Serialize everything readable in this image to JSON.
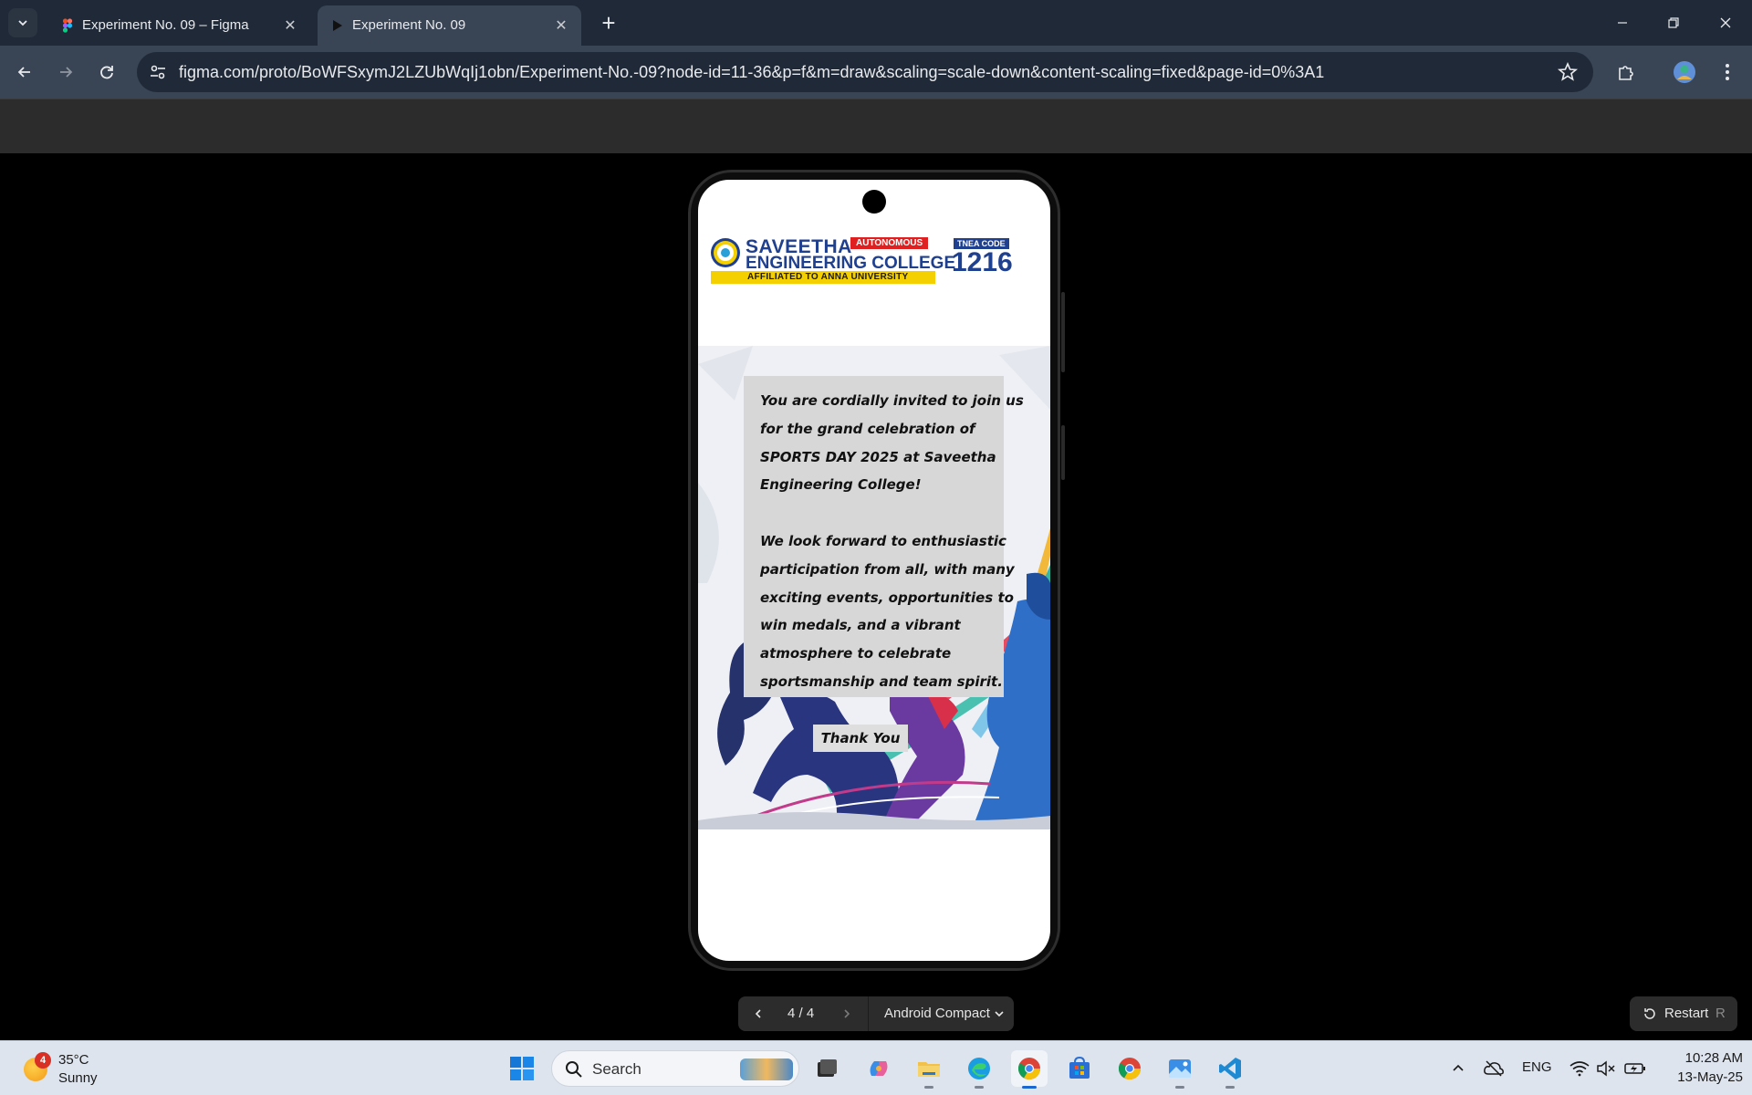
{
  "browser": {
    "tabs": [
      {
        "title": "Experiment No. 09 – Figma",
        "favicon": "figma-icon",
        "active": false
      },
      {
        "title": "Experiment No. 09",
        "favicon": "play-icon",
        "active": true
      }
    ],
    "url": "figma.com/proto/BoWFSxymJ2LZUbWqIj1obn/Experiment-No.-09?node-id=11-36&p=f&m=draw&scaling=scale-down&content-scaling=fixed&page-id=0%3A1",
    "colors": {
      "tabstrip": "#1f2937",
      "toolbar": "#394455",
      "omnibox": "#1f2937"
    }
  },
  "prototype": {
    "logo": {
      "line1": "SAVEETHA",
      "autonomous_badge": "AUTONOMOUS",
      "line2": "ENGINEERING COLLEGE",
      "affiliation": "AFFILIATED TO ANNA UNIVERSITY",
      "tnea_label": "TNEA CODE",
      "tnea_code": "1216"
    },
    "invitation": {
      "paragraph1": "You are cordially invited to join us for the grand celebration of SPORTS DAY 2025 at Saveetha Engineering College!",
      "paragraph2": "We look forward to enthusiastic participation from all, with many exciting events, opportunities to win medals, and a vibrant atmosphere to celebrate sportsmanship and team spirit."
    },
    "thank_you": "Thank You"
  },
  "viewer": {
    "page_counter": "4 / 4",
    "device": "Android Compact",
    "restart_label": "Restart",
    "restart_shortcut": "R"
  },
  "taskbar": {
    "weather": {
      "temp": "35°C",
      "condition": "Sunny",
      "badge": "4"
    },
    "search_placeholder": "Search",
    "language": "ENG",
    "time": "10:28 AM",
    "date": "13-May-25",
    "apps": [
      "windows-start-icon",
      "task-view-icon",
      "copilot-icon",
      "file-explorer-icon",
      "edge-icon",
      "chrome-icon",
      "microsoft-store-icon",
      "chrome-icon",
      "photos-icon",
      "vscode-icon"
    ]
  }
}
